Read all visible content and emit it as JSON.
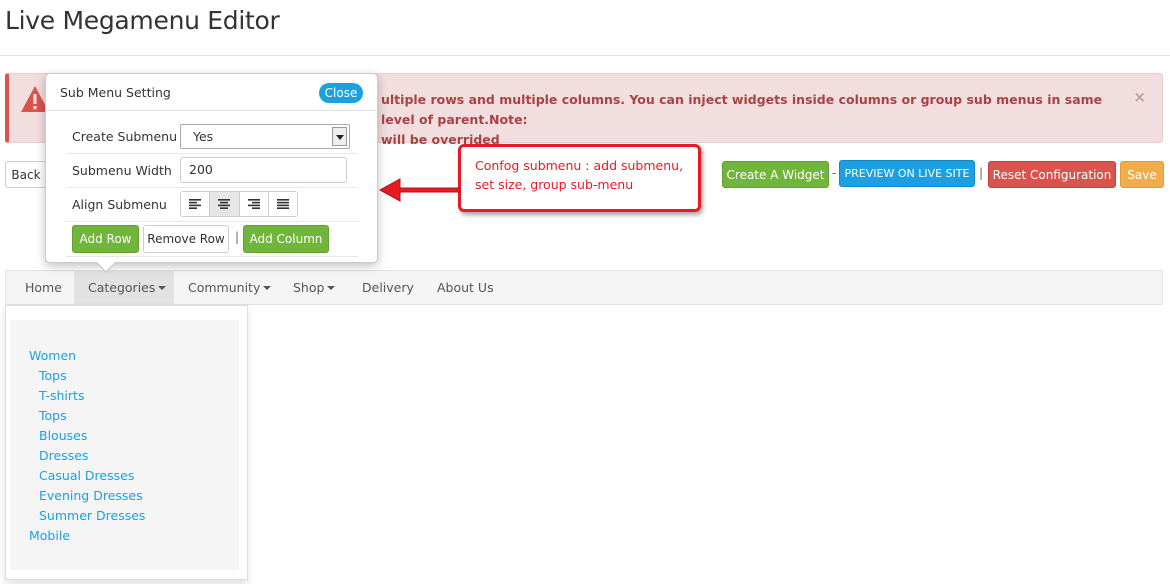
{
  "page": {
    "title": "Live Megamenu Editor"
  },
  "alert": {
    "text": "ultiple rows and multiple columns. You can inject widgets inside columns or group sub menus in same level of parent.Note: will be overrided",
    "line1": "ultiple rows and multiple columns. You can inject widgets inside columns or group sub menus in same level of parent.Note:",
    "line2": "will be overrided",
    "close_label": "×",
    "icon": "warning-icon"
  },
  "toolbar": {
    "back_label": "Back",
    "create_widget_label": "Create A Widget",
    "sep1": "-",
    "preview_label": "PREVIEW ON LIVE SITE",
    "sep2": "|",
    "reset_label": "Reset Configuration",
    "save_label": "Save"
  },
  "callout": {
    "text_line1": "Confog submenu : add submenu,",
    "text_line2": "set size, group sub-menu"
  },
  "popover": {
    "title": "Sub Menu Setting",
    "close_label": "Close",
    "create_submenu_label": "Create Submenu",
    "create_submenu_value": "Yes",
    "submenu_width_label": "Submenu Width",
    "submenu_width_value": "200",
    "align_submenu_label": "Align Submenu",
    "align_options": [
      "align-left-icon",
      "align-center-icon",
      "align-right-icon",
      "align-justify-icon"
    ],
    "add_row_label": "Add Row",
    "remove_row_label": "Remove Row",
    "separator": "|",
    "add_column_label": "Add Column"
  },
  "nav": {
    "items": [
      {
        "label": "Home"
      },
      {
        "label": "Categories"
      },
      {
        "label": "Community"
      },
      {
        "label": "Shop"
      },
      {
        "label": "Delivery"
      },
      {
        "label": "About Us"
      }
    ]
  },
  "dropdown": {
    "links": [
      "Women",
      "Tops",
      "T-shirts",
      "Tops",
      "Blouses",
      "Dresses",
      "Casual Dresses",
      "Evening Dresses",
      "Summer Dresses",
      "Mobile"
    ]
  },
  "colors": {
    "accent_blue": "#1ba1e2",
    "green": "#72b53c",
    "red": "#d9534f",
    "orange": "#f0ad4e",
    "callout_red": "#e51c23"
  }
}
